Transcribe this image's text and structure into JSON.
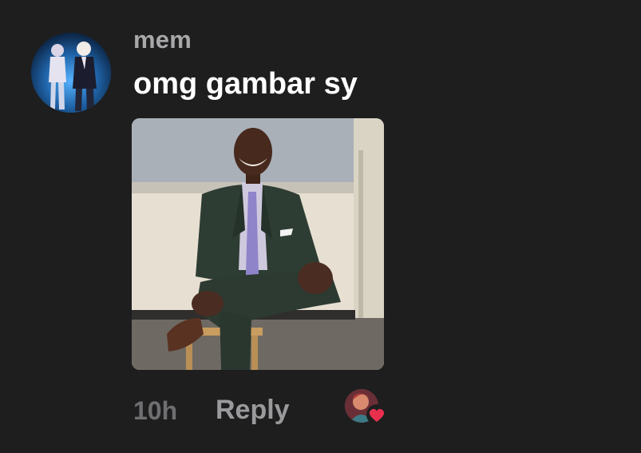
{
  "comment": {
    "username": "mem",
    "text": "omg gambar sy",
    "time": "10h",
    "reply_label": "Reply"
  },
  "icons": {
    "avatar": "user-avatar",
    "reaction": "heart-icon"
  },
  "colors": {
    "background": "#1e1e1f",
    "username": "#a8a8aa",
    "text": "#ffffff",
    "meta": "#6f6f72",
    "reply": "#9a9a9d",
    "heart": "#e8304e"
  }
}
